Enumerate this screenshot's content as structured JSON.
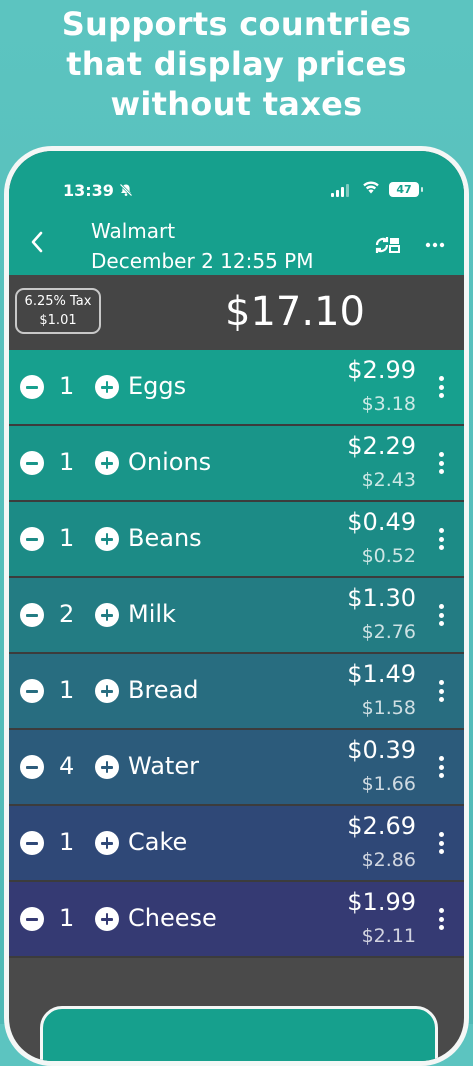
{
  "promo": {
    "line1": "Supports countries",
    "line2": "that display prices",
    "line3": "without taxes"
  },
  "status": {
    "time": "13:39",
    "battery": "47",
    "icons": [
      "bell-slash-icon",
      "signal-icon",
      "wifi-icon",
      "battery-icon"
    ]
  },
  "header": {
    "store": "Walmart",
    "date": "December 2 12:55 PM",
    "icons": [
      "back-icon",
      "swap-icon",
      "more-icon"
    ]
  },
  "summary": {
    "tax_label": "6.25% Tax",
    "tax_amount": "$1.01",
    "total": "$17.10"
  },
  "items": [
    {
      "qty": "1",
      "name": "Eggs",
      "price": "$2.99",
      "total": "$3.18",
      "color": "#17a08e"
    },
    {
      "qty": "1",
      "name": "Onions",
      "price": "$2.29",
      "total": "$2.43",
      "color": "#199589"
    },
    {
      "qty": "1",
      "name": "Beans",
      "price": "$0.49",
      "total": "$0.52",
      "color": "#1c8b86"
    },
    {
      "qty": "2",
      "name": "Milk",
      "price": "$1.30",
      "total": "$2.76",
      "color": "#237c83"
    },
    {
      "qty": "1",
      "name": "Bread",
      "price": "$1.49",
      "total": "$1.58",
      "color": "#286d80"
    },
    {
      "qty": "4",
      "name": "Water",
      "price": "$0.39",
      "total": "$1.66",
      "color": "#2c5b7b"
    },
    {
      "qty": "1",
      "name": "Cake",
      "price": "$2.69",
      "total": "$2.86",
      "color": "#2f4877"
    },
    {
      "qty": "1",
      "name": "Cheese",
      "price": "$1.99",
      "total": "$2.11",
      "color": "#353a73"
    }
  ]
}
